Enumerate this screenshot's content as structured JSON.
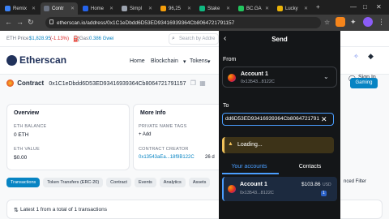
{
  "browser": {
    "tabs": [
      {
        "label": "Remix",
        "color": "#3b82f6"
      },
      {
        "label": "Contr",
        "color": "#6b7280"
      },
      {
        "label": "Home",
        "color": "#2563eb"
      },
      {
        "label": "Simpl",
        "color": "#9ca3af"
      },
      {
        "label": "96,25",
        "color": "#f59e0b"
      },
      {
        "label": "Stake",
        "color": "#10b981"
      },
      {
        "label": "BC.GA",
        "color": "#22c55e"
      },
      {
        "label": "Lucky",
        "color": "#eab308"
      }
    ],
    "url": "etherscan.io/address/0x1C1eDbdd6D53ED93416939364Cb8064721791157",
    "new_tab": "+"
  },
  "etherscan": {
    "eth_price_label": "ETH Price:",
    "eth_price_value": "$1,828.95",
    "eth_price_change": "(-1.13%)",
    "gas_label": "Gas:",
    "gas_value": "0.386 Gwei",
    "search_placeholder": "Search by Addre",
    "logo_text": "Etherscan",
    "nav": {
      "home": "Home",
      "blockchain": "Blockchain",
      "tokens": "Tokens"
    },
    "sign_in": "Sign In",
    "contract_label": "Contract",
    "contract_address": "0x1C1eDbdd6D53ED93416939364Cb8064721791157",
    "overview": {
      "title": "Overview",
      "eth_balance_label": "ETH BALANCE",
      "eth_balance_value": "0 ETH",
      "eth_value_label": "ETH VALUE",
      "eth_value_value": "$0.00"
    },
    "more_info": {
      "title": "More Info",
      "private_tags_label": "PRIVATE NAME TAGS",
      "add_label": "+ Add",
      "creator_label": "CONTRACT CREATOR",
      "creator_value": "0x13543aEa...18f9B122C",
      "creator_suffix": "26 d"
    },
    "tabs": [
      "Transactions",
      "Token Transfers (ERC-20)",
      "Contract",
      "Events",
      "Analytics",
      "Assets"
    ],
    "latest_text": "Latest 1 from a total of 1 transactions",
    "advanced_filter": "nced Filter",
    "gaming_btn": "Gaming"
  },
  "metamask": {
    "title": "Send",
    "from_label": "From",
    "account_name": "Account 1",
    "account_short": "0x13543...8122C",
    "to_label": "To",
    "to_value": "dd6D53ED93416939364Cb8064721791157",
    "loading_text": "Loading...",
    "tab_your_accounts": "Your accounts",
    "tab_contacts": "Contacts",
    "list_account_name": "Account 1",
    "list_account_short": "0x13543...8122C",
    "list_balance": "$103.86",
    "list_currency": "USD",
    "list_badge": "1"
  },
  "colors": {
    "accent_blue": "#0784c3",
    "metamask_blue": "#4a9eff",
    "warning_yellow": "#f0c15a",
    "price_down": "#dc2626"
  }
}
